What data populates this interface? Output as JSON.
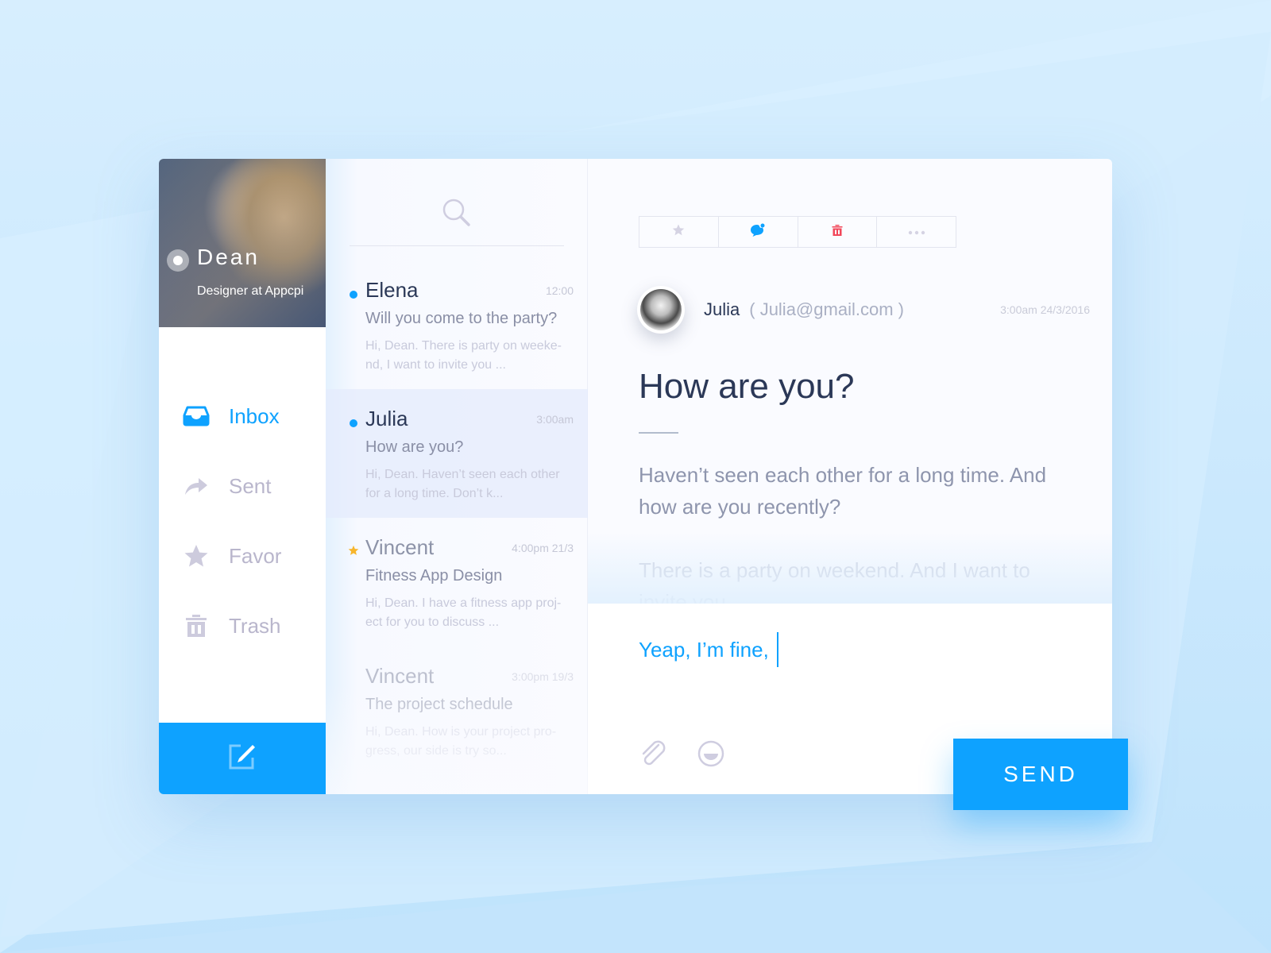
{
  "profile": {
    "name": "Dean",
    "role": "Designer at Appcpi",
    "status": "online"
  },
  "nav": {
    "items": [
      {
        "label": "Inbox",
        "icon": "inbox-icon",
        "active": true
      },
      {
        "label": "Sent",
        "icon": "sent-arrow-icon",
        "active": false
      },
      {
        "label": "Favor",
        "icon": "star-icon",
        "active": false
      },
      {
        "label": "Trash",
        "icon": "trash-icon",
        "active": false
      }
    ],
    "compose_icon": "compose-edit-icon"
  },
  "search": {
    "icon": "search-icon"
  },
  "messages": [
    {
      "sender": "Elena",
      "time": "12:00",
      "subject": "Will you come to the party?",
      "preview": "Hi, Dean. There is party on weeke-nd, I want to invite you ...",
      "marker": "unread-dot",
      "selected": false
    },
    {
      "sender": "Julia",
      "time": "3:00am",
      "subject": "How are you?",
      "preview": "Hi, Dean. Haven’t seen each other for a long time. Don’t k...",
      "marker": "unread-dot",
      "selected": true
    },
    {
      "sender": "Vincent",
      "time": "4:00pm 21/3",
      "subject": "Fitness App Design",
      "preview": "Hi, Dean. I have a fitness app proj-ect for you to discuss ...",
      "marker": "star",
      "selected": false
    },
    {
      "sender": "Vincent",
      "time": "3:00pm 19/3",
      "subject": "The project schedule",
      "preview": "Hi, Dean. How is your project pro-gress, our side is try so...",
      "marker": "none",
      "selected": false
    }
  ],
  "toolbar": {
    "buttons": [
      {
        "icon": "star-icon",
        "label": "Favorite"
      },
      {
        "icon": "chat-bubble-icon",
        "label": "Reply"
      },
      {
        "icon": "trash-icon",
        "label": "Delete"
      },
      {
        "icon": "more-dots-icon",
        "label": "More"
      }
    ]
  },
  "email": {
    "from_name": "Julia",
    "from_email": "( Julia@gmail.com )",
    "date": "3:00am 24/3/2016",
    "subject": "How are you?",
    "body_paragraph_1": "Haven’t seen each other for a long time. And how are you recently?",
    "body_paragraph_2": "There is a party on weekend. And I want to invite you."
  },
  "reply": {
    "text": "Yeap, I’m fine,",
    "attach_icon": "paperclip-icon",
    "emoji_icon": "emoji-icon",
    "send_label": "SEND"
  },
  "colors": {
    "accent": "#0ea2ff",
    "delete": "#f2475a",
    "star": "#f7b52c",
    "text_dark": "#2b3857",
    "text_muted": "#8e95ad",
    "icon_muted": "#c9c7db"
  }
}
